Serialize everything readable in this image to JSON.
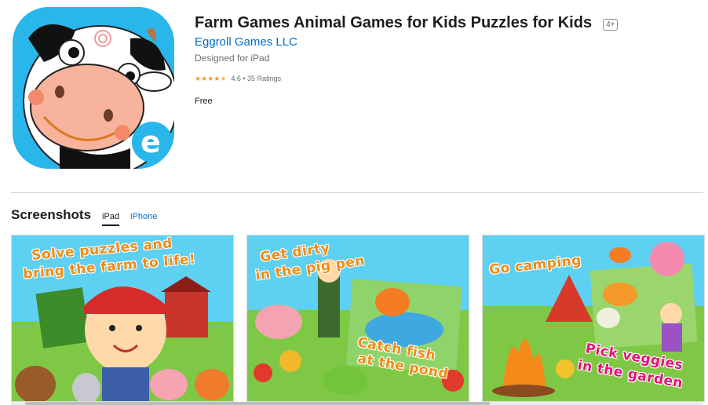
{
  "app": {
    "title": "Farm Games Animal Games for Kids Puzzles for Kids",
    "age_rating": "4+",
    "developer": "Eggroll Games LLC",
    "designed_for": "Designed for iPad",
    "rating_text": "4.6 • 35 Ratings",
    "rating_value": 4.6,
    "price": "Free"
  },
  "screenshots": {
    "heading": "Screenshots",
    "tabs": [
      {
        "label": "iPad",
        "active": true
      },
      {
        "label": "iPhone",
        "active": false
      }
    ],
    "items": [
      {
        "caption_line1": "Solve puzzles and",
        "caption_line2": "bring the farm to life!"
      },
      {
        "caption_top1": "Get dirty",
        "caption_top2": "in the pig pen",
        "caption_bottom1": "Catch fish",
        "caption_bottom2": "at the pond"
      },
      {
        "caption_top": "Go camping",
        "caption_bottom1": "Pick veggies",
        "caption_bottom2": "in the garden"
      }
    ]
  },
  "colors": {
    "link": "#0070c9",
    "star": "#f49c1a",
    "icon_bg": "#29b6ea"
  }
}
